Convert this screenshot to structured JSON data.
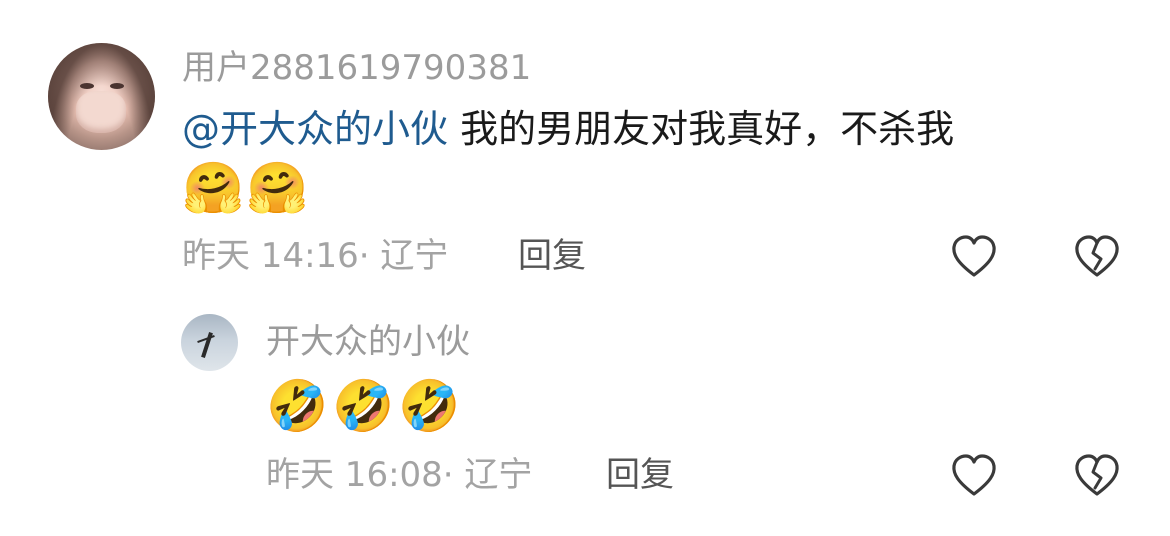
{
  "comment": {
    "username": "用户2881619790381",
    "mention": "@开大众的小伙",
    "text": "我的男朋友对我真好，不杀我",
    "emojis": [
      "🤗",
      "🤗"
    ],
    "meta": "昨天 14:16· 辽宁",
    "reply_label": "回复",
    "like_icon": "heart-outline-icon",
    "dislike_icon": "broken-heart-outline-icon"
  },
  "reply": {
    "username": "开大众的小伙",
    "emojis": [
      "🤣",
      "🤣",
      "🤣"
    ],
    "meta": "昨天 16:08· 辽宁",
    "reply_label": "回复",
    "like_icon": "heart-outline-icon",
    "dislike_icon": "broken-heart-outline-icon"
  },
  "colors": {
    "mention": "#1f5b8f",
    "username": "#9b9b9b",
    "meta": "#a3a3a3",
    "reply": "#555555",
    "icon": "#3a3a3a"
  }
}
